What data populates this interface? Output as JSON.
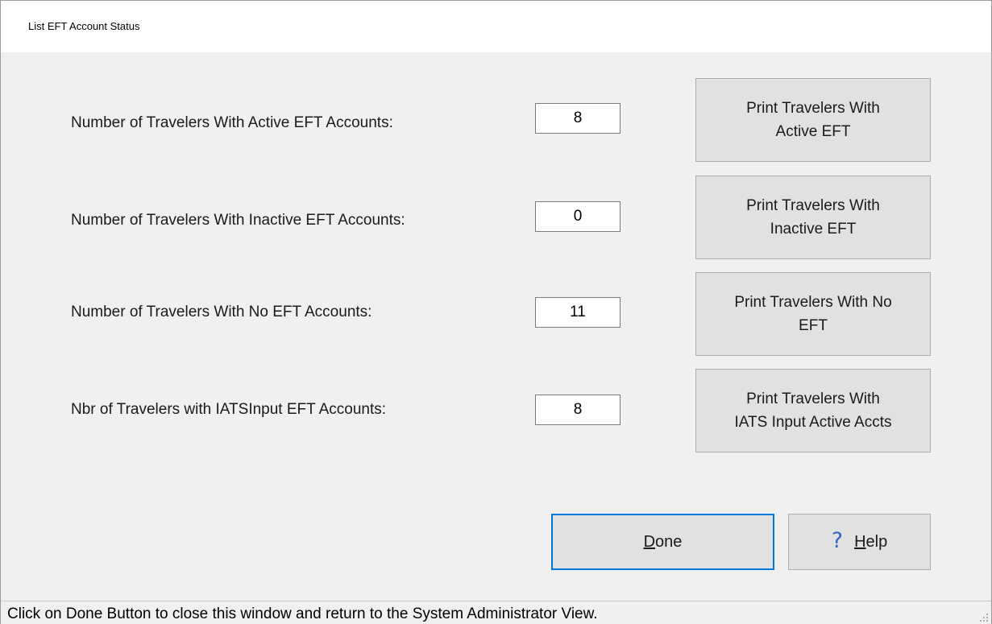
{
  "window": {
    "title": "List EFT Account Status"
  },
  "rows": [
    {
      "label": "Number of Travelers With Active EFT Accounts:",
      "value": "8",
      "button_line1": "Print Travelers With",
      "button_line2": "Active EFT"
    },
    {
      "label": "Number of Travelers With Inactive EFT Accounts:",
      "value": "0",
      "button_line1": "Print Travelers With",
      "button_line2": "Inactive EFT"
    },
    {
      "label": "Number of Travelers With No EFT Accounts:",
      "value": "11",
      "button_line1": "Print Travelers With No",
      "button_line2": "EFT"
    },
    {
      "label": "Nbr of Travelers with IATSInput EFT Accounts:",
      "value": "8",
      "button_line1": "Print Travelers With",
      "button_line2": "IATS Input Active Accts"
    }
  ],
  "buttons": {
    "done": {
      "mnemonic": "D",
      "rest": "one"
    },
    "help": {
      "icon": "question-mark-icon",
      "icon_glyph": "?",
      "mnemonic": "H",
      "rest": "elp"
    }
  },
  "statusbar": {
    "text": "Click on Done Button to close this window and return to the System Administrator View."
  },
  "colors": {
    "focus_border": "#0078d7",
    "help_icon": "#2f66c8",
    "button_face": "#e1e1e1",
    "window_bg": "#f0f0f0"
  }
}
